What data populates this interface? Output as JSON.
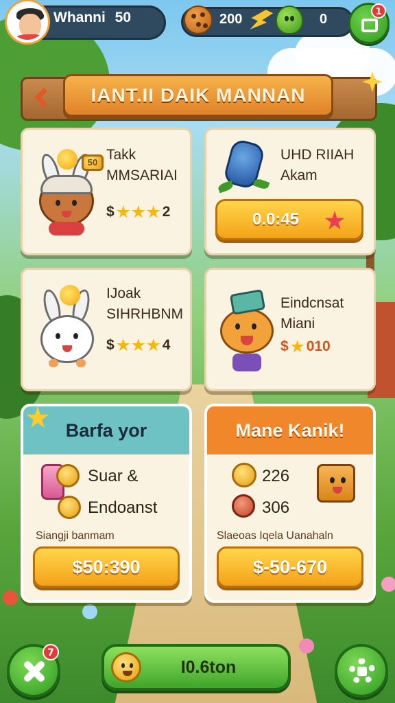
{
  "hud": {
    "player_name": "Whanni",
    "player_level": "50",
    "coins": "200",
    "gems": "0",
    "shop_badge": "1"
  },
  "banner": {
    "title": "IANT.II DAIK MANNAN"
  },
  "cards": [
    {
      "title_line1": "Takk",
      "title_line2": "MMSARIAI",
      "price_prefix": "$",
      "stars": 3,
      "price_suffix": "2",
      "badge": "50"
    },
    {
      "title_line1": "UHD RIIAH",
      "title_line2": "Akam",
      "timer": "0.0:45"
    },
    {
      "title_line1": "IJoak",
      "title_line2": "SIHRHBNM",
      "price_prefix": "$",
      "stars": 3,
      "price_suffix": "4"
    },
    {
      "title_line1": "Eindcnsat",
      "title_line2": "Miani",
      "price_prefix": "$",
      "stars": 1,
      "price_suffix": "010"
    }
  ],
  "offers": [
    {
      "header": "Barfa yor",
      "line1": "Suar &",
      "line2": "Endoanst",
      "subtitle": "Siangji banmam",
      "price": "$50:390"
    },
    {
      "header": "Mane Kanik!",
      "line1": "226",
      "line2": "306",
      "subtitle": "Slaeoas Iqela Uanahaln",
      "price": "$-50-670"
    }
  ],
  "bottom": {
    "main_label": "I0.6ton",
    "close_badge": "7"
  },
  "colors": {
    "accent_orange": "#f0872a",
    "accent_green": "#3fa52a",
    "button_gold": "#f4a21a",
    "hud_panel": "#2f4a5f"
  },
  "icons": [
    "avatar",
    "cookie-icon",
    "bolt-icon",
    "green-blob-icon",
    "shop-bag-icon",
    "back-arrow-icon",
    "gear-icon",
    "close-icon",
    "smiley-coin-icon"
  ]
}
